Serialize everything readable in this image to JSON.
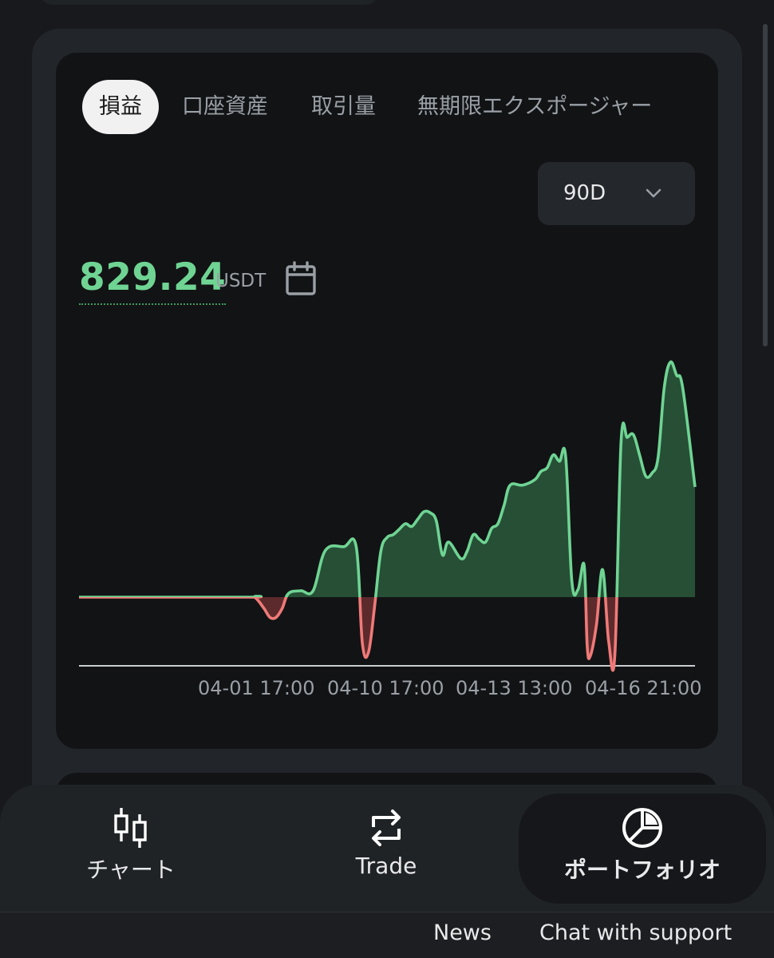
{
  "tabs": [
    {
      "label": "損益",
      "active": true
    },
    {
      "label": "口座資産",
      "active": false
    },
    {
      "label": "取引量",
      "active": false
    },
    {
      "label": "無期限エクスポージャー",
      "active": false
    }
  ],
  "period": {
    "selected": "90D"
  },
  "summary": {
    "value": "829.24",
    "unit": "USDT"
  },
  "chart_data": {
    "type": "area",
    "x_ticks": [
      "04-01 17:00",
      "04-10 17:00",
      "04-13 13:00",
      "04-16 21:00"
    ],
    "colors": {
      "positive": "#6fd493",
      "negative": "#ef7a78",
      "baseline": "#c9ccd1"
    },
    "x": [
      0,
      27,
      28.5,
      30,
      31,
      32,
      33,
      34,
      36,
      38,
      40,
      43,
      45,
      46,
      47,
      48,
      49,
      50,
      51,
      52,
      53,
      54,
      55,
      56,
      57,
      58,
      59,
      60,
      62,
      63,
      64,
      65,
      66,
      67,
      68,
      69,
      70,
      72,
      74,
      75,
      76,
      77,
      78,
      79,
      80,
      81,
      82,
      82.5,
      83,
      84,
      85,
      86,
      87,
      88,
      89,
      90,
      91,
      92,
      93,
      94,
      95,
      96,
      97,
      98,
      100
    ],
    "y": [
      0,
      0,
      0,
      -120,
      -220,
      -220,
      -120,
      40,
      70,
      70,
      510,
      550,
      550,
      -500,
      -600,
      -90,
      500,
      650,
      680,
      740,
      800,
      770,
      850,
      930,
      920,
      830,
      460,
      600,
      420,
      500,
      680,
      630,
      600,
      750,
      800,
      1000,
      1220,
      1220,
      1280,
      1370,
      1410,
      1550,
      1480,
      1530,
      180,
      80,
      350,
      -530,
      -640,
      -300,
      300,
      -490,
      -620,
      1700,
      1740,
      1770,
      1550,
      1320,
      1350,
      1520,
      2280,
      2560,
      2420,
      2280,
      1200
    ]
  },
  "bottom_nav": [
    {
      "label": "チャート",
      "icon": "candlestick-icon",
      "active": false
    },
    {
      "label": "Trade",
      "icon": "swap-arrows-icon",
      "active": false
    },
    {
      "label": "ポートフォリオ",
      "icon": "pie-chart-icon",
      "active": true
    }
  ],
  "footer": {
    "news": "News",
    "chat": "Chat with support"
  }
}
